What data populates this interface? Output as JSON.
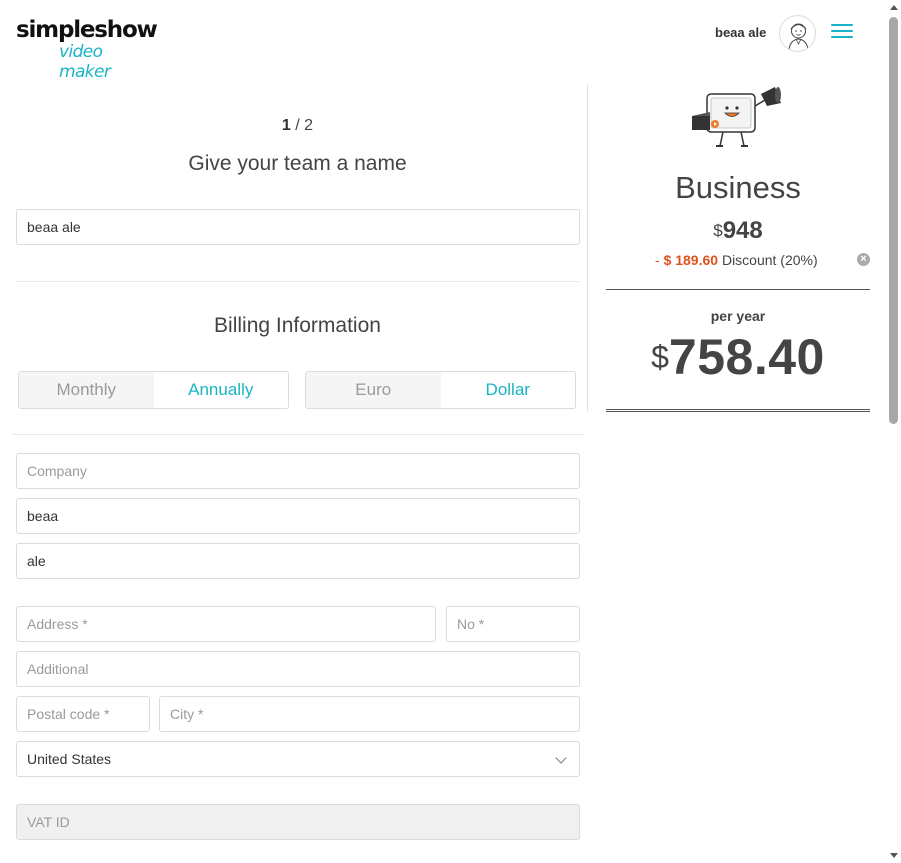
{
  "header": {
    "logo_top": "simpleshow",
    "logo_bottom": "video maker",
    "user_name": "beaa ale"
  },
  "form": {
    "step_current": "1",
    "step_total": " / 2",
    "team_title": "Give your team a name",
    "team_name_value": "beaa ale",
    "billing_title": "Billing Information",
    "period_toggle": {
      "monthly": "Monthly",
      "annually": "Annually",
      "selected": "Annually"
    },
    "currency_toggle": {
      "euro": "Euro",
      "dollar": "Dollar",
      "selected": "Dollar"
    },
    "company_placeholder": "Company",
    "first_name_value": "beaa",
    "last_name_value": "ale",
    "address_placeholder": "Address *",
    "number_placeholder": "No *",
    "additional_placeholder": "Additional",
    "postal_placeholder": "Postal code *",
    "city_placeholder": "City *",
    "country_value": "United States",
    "vat_placeholder": "VAT ID"
  },
  "summary": {
    "plan_name": "Business",
    "currency_symbol": "$",
    "base_price": "948",
    "discount_minus": "- ",
    "discount_amount": "$ 189.60",
    "discount_label": " Discount (20%)",
    "period_label": "per year",
    "total_price": "758.40"
  },
  "colors": {
    "accent": "#1ab4c6",
    "discount": "#e0531f"
  }
}
